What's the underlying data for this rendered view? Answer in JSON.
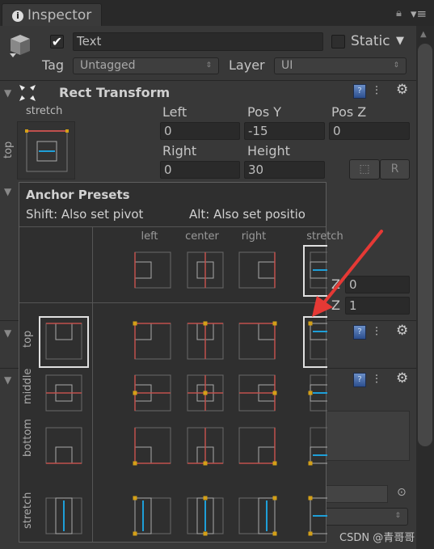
{
  "tab": {
    "title": "Inspector",
    "icon": "info-icon"
  },
  "object": {
    "active": true,
    "name": "Text",
    "static_label": "Static",
    "static": false,
    "tag_label": "Tag",
    "tag_value": "Untagged",
    "layer_label": "Layer",
    "layer_value": "UI"
  },
  "rect_transform": {
    "title": "Rect Transform",
    "anchor_h": "stretch",
    "anchor_v": "top",
    "labels": [
      "Left",
      "Pos Y",
      "Pos Z",
      "Right",
      "Height"
    ],
    "values": [
      "0",
      "-15",
      "0",
      "0",
      "30"
    ],
    "blueprint_button": "⬚",
    "raw_button": "R"
  },
  "background": {
    "z0_label": "Z",
    "z0_value": "0",
    "z1_label": "Z",
    "z1_value": "1"
  },
  "anchor_presets": {
    "title": "Anchor Presets",
    "hint_shift": "Shift: Also set pivot",
    "hint_alt": "Alt: Also set positio",
    "columns": [
      "left",
      "center",
      "right",
      "stretch"
    ],
    "rows": [
      "top",
      "middle",
      "bottom",
      "stretch"
    ],
    "selected": {
      "row": "top",
      "column": "stretch"
    }
  },
  "watermark": "CSDN @青哥哥",
  "colors": {
    "anchor_red": "#c0504d",
    "anchor_yellow": "#d4a017",
    "stretch_blue": "#1e9fd8",
    "highlight": "#e0e0e0",
    "arrow": "#e53935"
  }
}
